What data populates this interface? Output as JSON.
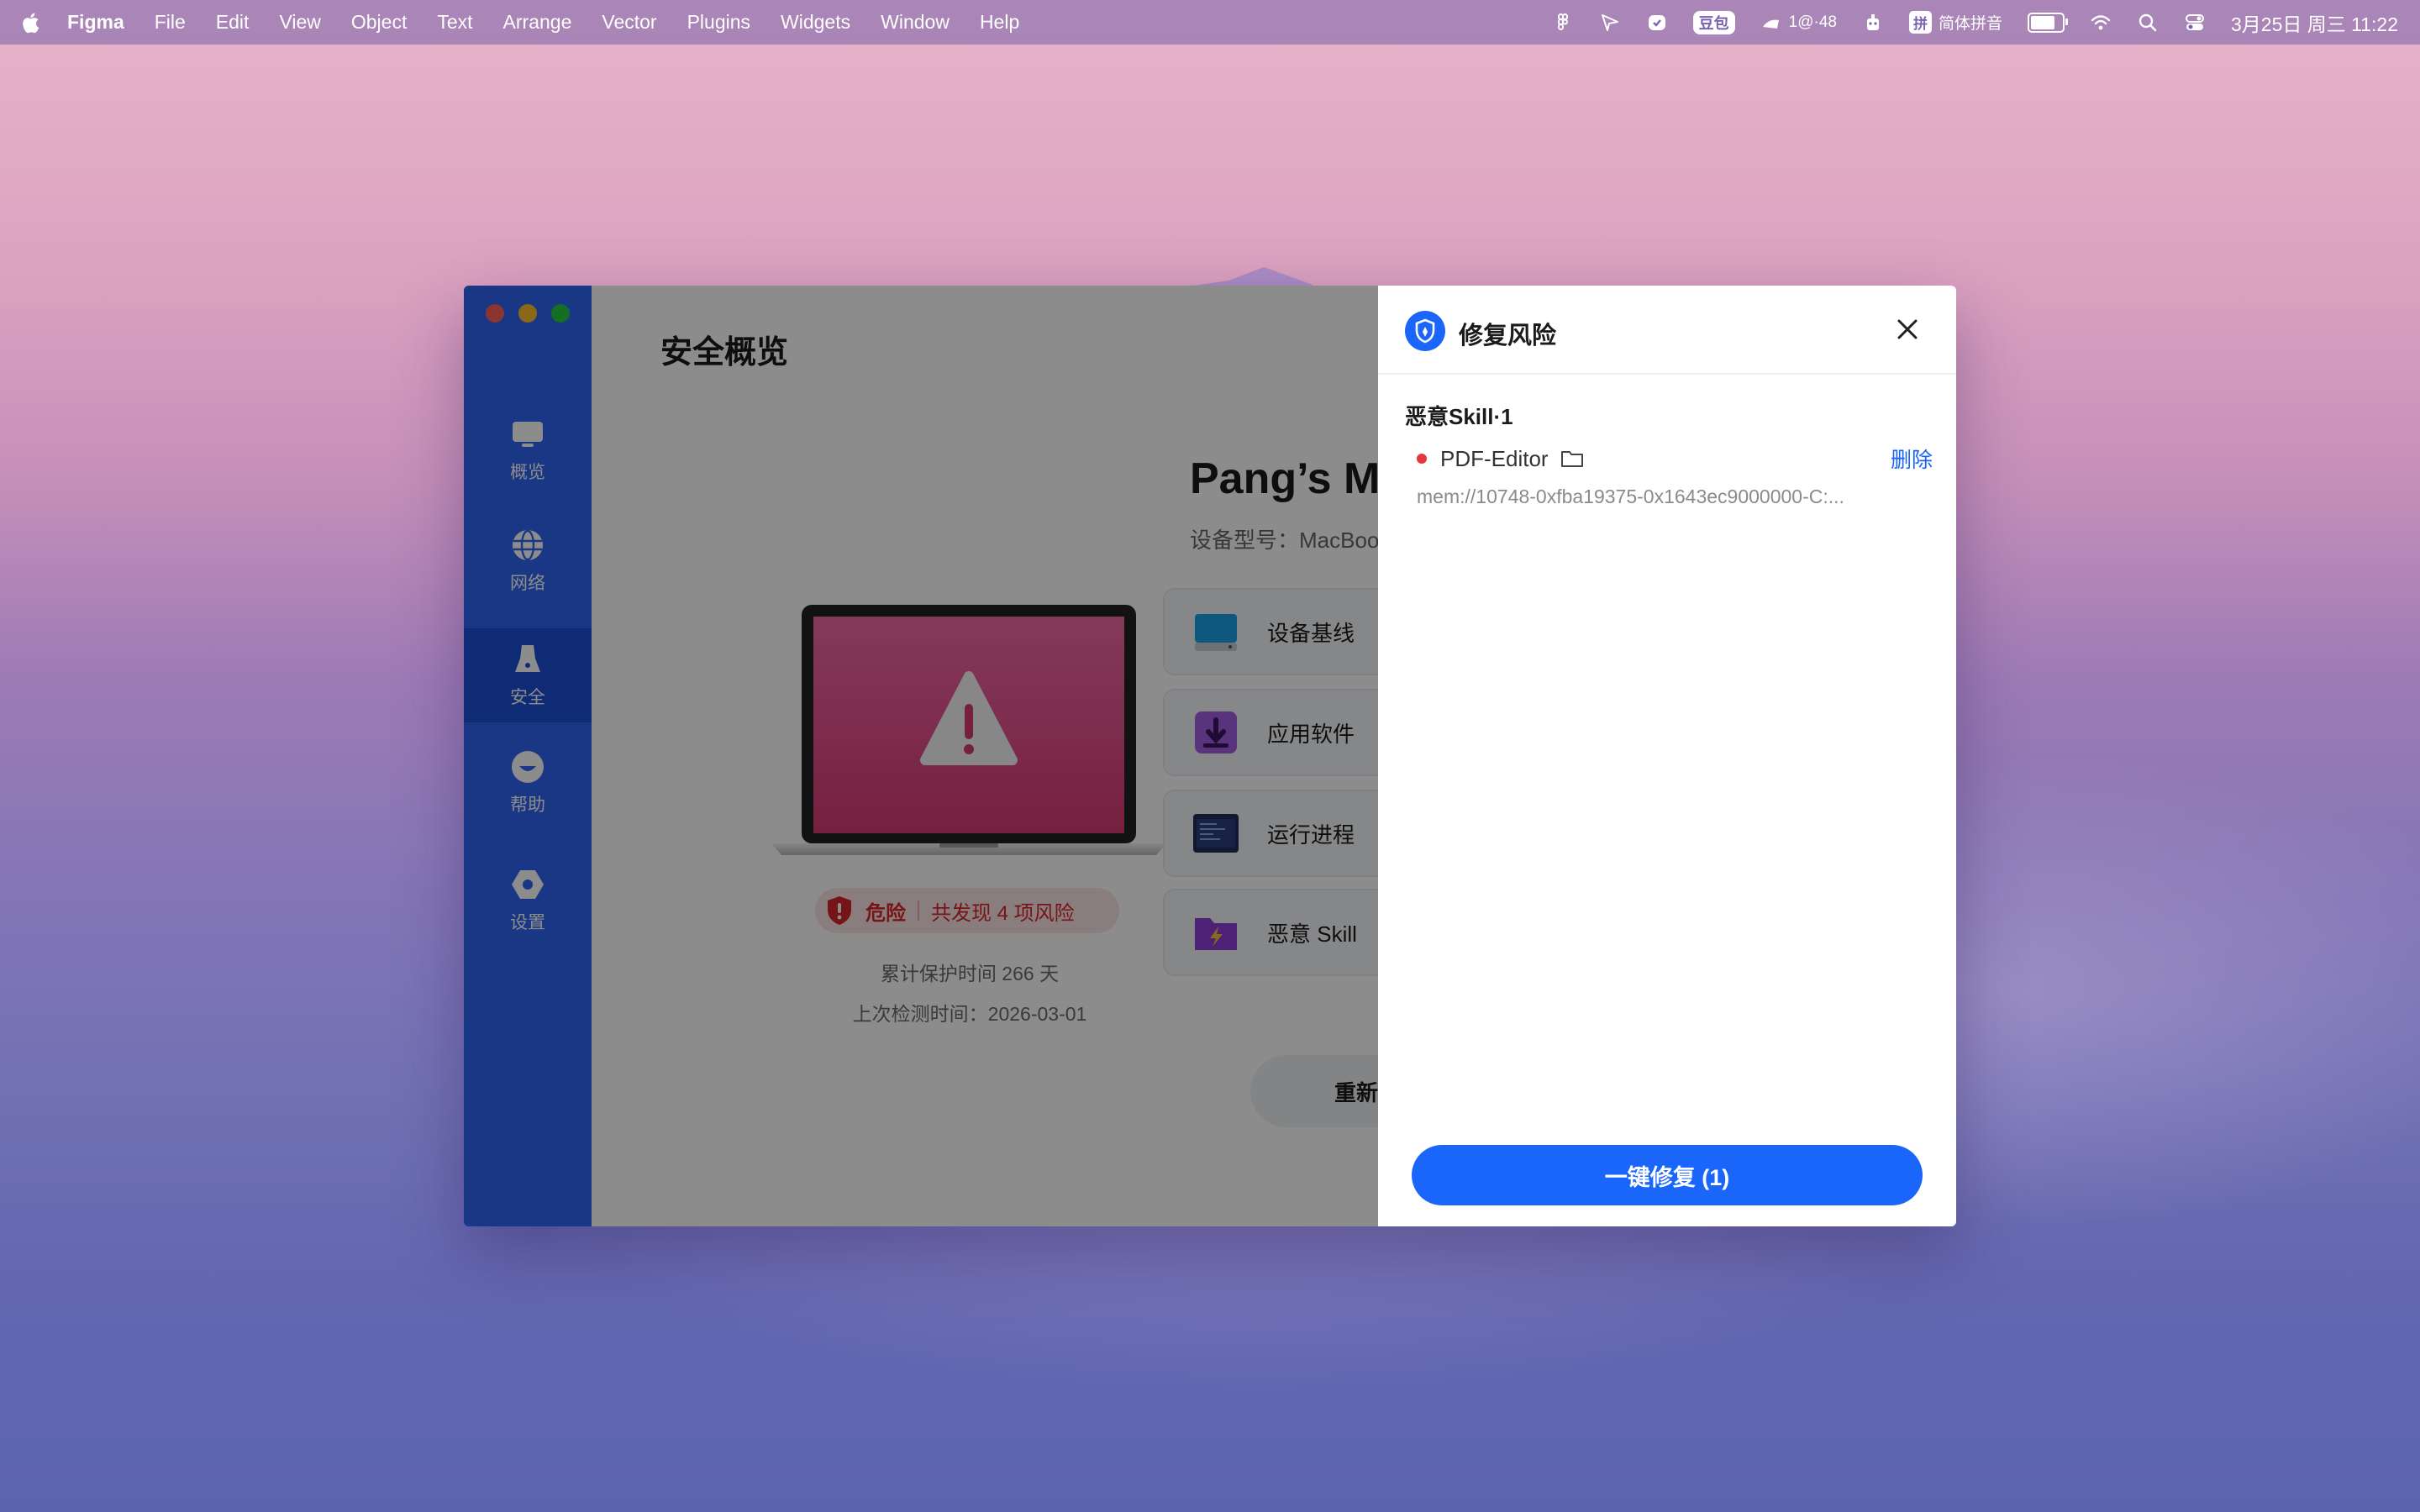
{
  "menubar": {
    "app_name": "Figma",
    "menus": [
      "File",
      "Edit",
      "View",
      "Object",
      "Text",
      "Arrange",
      "Vector",
      "Plugins",
      "Widgets",
      "Window",
      "Help"
    ],
    "status": {
      "pill": "豆包",
      "tray_text": "1@·48",
      "ime_box": "拼",
      "ime_label": "简体拼音",
      "datetime": "3月25日 周三  11:22"
    }
  },
  "sidebar": {
    "items": [
      {
        "label": "概览",
        "icon": "monitor-icon"
      },
      {
        "label": "网络",
        "icon": "globe-icon"
      },
      {
        "label": "安全",
        "icon": "security-icon"
      },
      {
        "label": "帮助",
        "icon": "help-icon"
      },
      {
        "label": "设置",
        "icon": "settings-icon"
      }
    ],
    "active": "安全"
  },
  "main": {
    "title": "安全概览",
    "device_name": "Pang’s M",
    "device_model": "设备型号：MacBoo",
    "risk_status": "危险",
    "risk_summary": "共发现 4 项风险",
    "protection_time": "累计保护时间   266   天",
    "last_scan": "上次检测时间：2026-03-01",
    "cards": [
      {
        "label": "设备基线",
        "icon": "disk-icon"
      },
      {
        "label": "应用软件",
        "icon": "app-install-icon"
      },
      {
        "label": "运行进程",
        "icon": "process-icon"
      },
      {
        "label": "恶意 Skill",
        "icon": "skill-folder-icon"
      }
    ],
    "rescan_label": "重新检"
  },
  "drawer": {
    "title": "修复风险",
    "group_title": "恶意Skill·1",
    "item_name": "PDF-Editor",
    "item_path": "mem://10748-0xfba19375-0x1643ec9000000-C:...",
    "delete_label": "删除",
    "fix_button": "一键修复 (1)"
  },
  "colors": {
    "sidebar": "#2e64f0",
    "primary": "#1a66fb",
    "danger": "#d9262b"
  }
}
